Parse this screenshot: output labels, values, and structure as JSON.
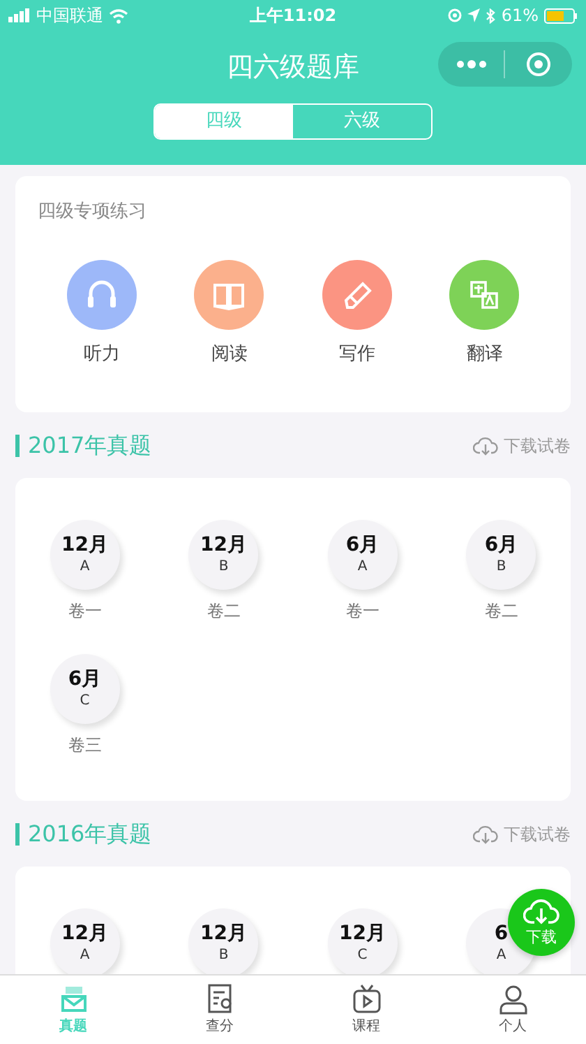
{
  "status_bar": {
    "carrier": "中国联通",
    "time": "上午11:02",
    "battery": "61%"
  },
  "header": {
    "title": "四六级题库"
  },
  "tabs": [
    {
      "label": "四级",
      "selected": true
    },
    {
      "label": "六级",
      "selected": false
    }
  ],
  "practice": {
    "title": "四级专项练习",
    "items": [
      {
        "kind": "listening",
        "label": "听力",
        "color": "#9db8f9"
      },
      {
        "kind": "reading",
        "label": "阅读",
        "color": "#fbb08c"
      },
      {
        "kind": "writing",
        "label": "写作",
        "color": "#fb9482"
      },
      {
        "kind": "translation",
        "label": "翻译",
        "color": "#7ed257"
      }
    ]
  },
  "sections": [
    {
      "title": "2017年真题",
      "download": "下载试卷",
      "papers": [
        {
          "month": "12月",
          "set": "A",
          "label": "卷一"
        },
        {
          "month": "12月",
          "set": "B",
          "label": "卷二"
        },
        {
          "month": "6月",
          "set": "A",
          "label": "卷一"
        },
        {
          "month": "6月",
          "set": "B",
          "label": "卷二"
        },
        {
          "month": "6月",
          "set": "C",
          "label": "卷三"
        }
      ]
    },
    {
      "title": "2016年真题",
      "download": "下载试卷",
      "papers": [
        {
          "month": "12月",
          "set": "A"
        },
        {
          "month": "12月",
          "set": "B"
        },
        {
          "month": "12月",
          "set": "C"
        },
        {
          "month": "6",
          "set": "A"
        }
      ]
    }
  ],
  "fab": {
    "label": "下载"
  },
  "tabbar": [
    {
      "kind": "exams",
      "label": "真题",
      "selected": true
    },
    {
      "kind": "scores",
      "label": "查分",
      "selected": false
    },
    {
      "kind": "courses",
      "label": "课程",
      "selected": false
    },
    {
      "kind": "profile",
      "label": "个人",
      "selected": false
    }
  ]
}
